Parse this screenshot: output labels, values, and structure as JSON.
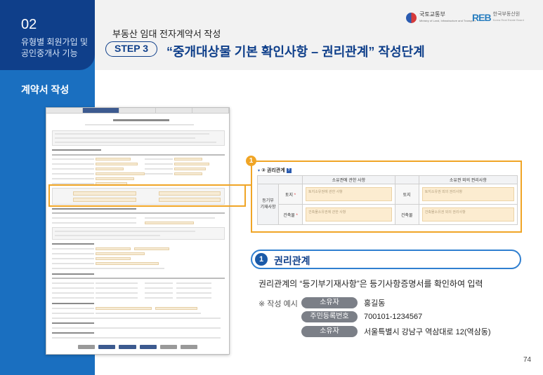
{
  "sidebar": {
    "section_number": "02",
    "section_desc_line1": "유형별 회원가입 및",
    "section_desc_line2": "공인중개사 기능",
    "label": "계약서 작성"
  },
  "header": {
    "subtitle": "부동산 임대 전자계약서 작성",
    "step": "STEP 3",
    "title": "“중개대상물 기본 확인사항 – 권리관계” 작성단계",
    "logo_molit": "국토교통부",
    "logo_molit_en": "Ministry of Land, Infrastructure and Transport",
    "logo_reb": "REB",
    "logo_reb_name": "한국부동산원",
    "logo_reb_en": "Korea Real Estate Board"
  },
  "zoom": {
    "badge": "1",
    "section_title": "② 권리관계",
    "help_icon": "?",
    "col_owner": "소유권에 관한 사항",
    "col_other": "소유권 외의 권리사항",
    "row_header_line1": "등기부",
    "row_header_line2": "기재사항",
    "land_label": "토지",
    "building_label": "건축물",
    "required_mark": "*",
    "ph_land_owner": "토지소유권에 관한 사항",
    "ph_land_other": "토지소유권 외의 권리사항",
    "ph_bldg_owner": "건축물소유권에 관한 사항",
    "ph_bldg_other": "건축물소유권 외의 권리사항"
  },
  "info": {
    "banner_num": "1",
    "banner_title": "권리관계",
    "description": "권리관계의 “등기부기재사항”은 등기사항증명서를 확인하여 입력",
    "example_label": "※ 작성 예시",
    "examples": [
      {
        "key": "소유자",
        "value": "홍길동"
      },
      {
        "key": "주민등록번호",
        "value": "700101-1234567"
      },
      {
        "key": "소유자",
        "value": "서울특별시 강남구 역삼대로 12(역삼동)"
      }
    ]
  },
  "page_number": "74",
  "colors": {
    "navy": "#0f3f8a",
    "blue": "#1a6fc0",
    "highlight": "#f0a526",
    "field": "#fcecd0"
  }
}
